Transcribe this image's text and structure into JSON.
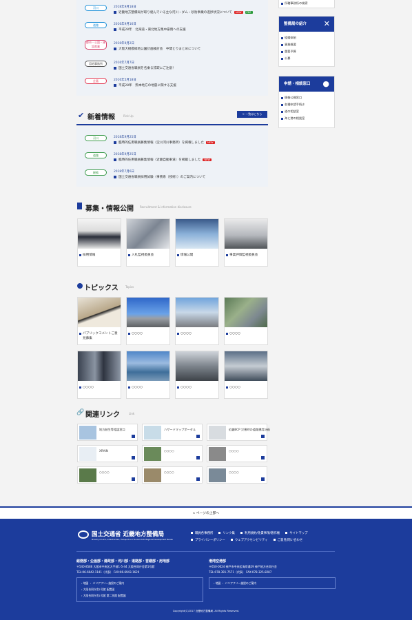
{
  "news_top": [
    {
      "badge": "河川",
      "badge_color": "#1c8fd8",
      "date": "2018年9月18日",
      "title": "近畿地方整備局が取り組んでいる主な河川・ダム・砂防事業の進捗状況について",
      "new": "NEW",
      "pdf": "PDF"
    },
    {
      "badge": "道路",
      "badge_color": "#1c8fd8",
      "date": "2016年9月16日",
      "title": "平成28年　北海道・東北地方集中豪雨への支援",
      "new": "",
      "pdf": ""
    },
    {
      "badge": "都市・公園・建設産業",
      "badge_color": "#d9416a",
      "date": "2016年9月2日",
      "title": "大阪大規模緑地公園計画検討会　中間とりまとめについて",
      "new": "",
      "pdf": ""
    },
    {
      "badge": "用地事務所",
      "badge_color": "#555555",
      "date": "2016年7月7日",
      "title": "国土交通省職員を名乗る詐欺にご注意！",
      "new": "",
      "pdf": ""
    },
    {
      "badge": "企画",
      "badge_color": "#e0304a",
      "date": "2016年5月18日",
      "title": "平成28年　熊本地方の地震に関する支援",
      "new": "",
      "pdf": ""
    }
  ],
  "sidebar": {
    "top_item": "所轄事務所の検索",
    "box1": {
      "title": "整備局の紹介",
      "items": [
        "組織体制",
        "事業概要",
        "重要予算",
        "公募"
      ]
    },
    "box2": {
      "title": "申請・相談窓口",
      "items": [
        "情報公開窓口",
        "各種申請手続き",
        "道の相談室",
        "海と港の相談室"
      ]
    }
  },
  "new_info": {
    "title": "新着情報",
    "sub": "Pick Up",
    "more": "一覧はこちら",
    "items": [
      {
        "badge": "河川",
        "date": "2018年9月25日",
        "title": "臨時的任用職員募集情報（淀川河川事務所）を掲載しました",
        "new": "NEW"
      },
      {
        "badge": "道路",
        "date": "2018年9月25日",
        "title": "臨時的任用職員募集情報（近畿自動車道）を掲載しました",
        "new": "NEW"
      },
      {
        "badge": "総務",
        "date": "2018年7月6日",
        "title": "国土交通省職員採用試験（事務系（技術））のご案内について",
        "new": ""
      }
    ]
  },
  "recruit": {
    "title": "募集・情報公開",
    "sub": "Recruitment & information disclosure",
    "cards": [
      "採用情報",
      "入札監視委員会",
      "情報公開",
      "事業評価監視委員会"
    ]
  },
  "topics": {
    "title": "トピックス",
    "sub": "Topics",
    "cards": [
      "パブリックコメントご意見募集",
      "○○○○",
      "○○○○",
      "○○○○",
      "○○○○",
      "○○○○",
      "○○○○",
      "○○○○"
    ]
  },
  "links": {
    "title": "関連リンク",
    "sub": "Link",
    "items": [
      "地方創生等相談窓口",
      "ハザードマップポータル",
      "近畿BCP 災害時の道路運用計画",
      "XRAIN",
      "○○○○",
      "○○○○",
      "○○○○",
      "○○○○",
      "○○○○"
    ]
  },
  "back_to_top": "ページの上部へ",
  "footer": {
    "brand": "国土交通省 近畿地方整備局",
    "brand_en": "Ministry of Land, Infrastructure, Transport and Tourism Kinki Regional Development Bureau",
    "nav1": [
      "職員各事務所",
      "リンク集",
      "利用規約/免責事項/著作権",
      "サイトマップ"
    ],
    "nav2": [
      "プライバシーポリシー",
      "ウェブアクセシビリティ",
      "ご意見/問い合わせ"
    ],
    "office1": {
      "title": "総務部・企画部・建政部・河川部・道路部・営繕部・用地部",
      "address": "〒540-8586 大阪市中央区大手前1-5-44 大阪合同庁舎第1号館",
      "tel": "TEL:06-6942-1141（代表） FAX:06-6943-1629",
      "links": [
        "地図 ・ バリアフリー施設のご案内",
        "大阪合同庁舎1号館 配置図",
        "大阪合同庁舎1号館 第二別館 配置図"
      ]
    },
    "office2": {
      "title": "港湾空港部",
      "address": "〒650-0024 神戸市中央区海岸通29 神戸地方合同庁舎",
      "tel": "TEL:078-391-7571（代表） FAX:078-325-8287",
      "links": [
        "地図 ・ バリアフリー施設のご案内"
      ]
    },
    "copyright": "Copyright(C)2017 近畿地方整備局. All Rights Reserved."
  },
  "colors": {
    "primary": "#1c3c9c",
    "accent": "#1c8fd8"
  }
}
